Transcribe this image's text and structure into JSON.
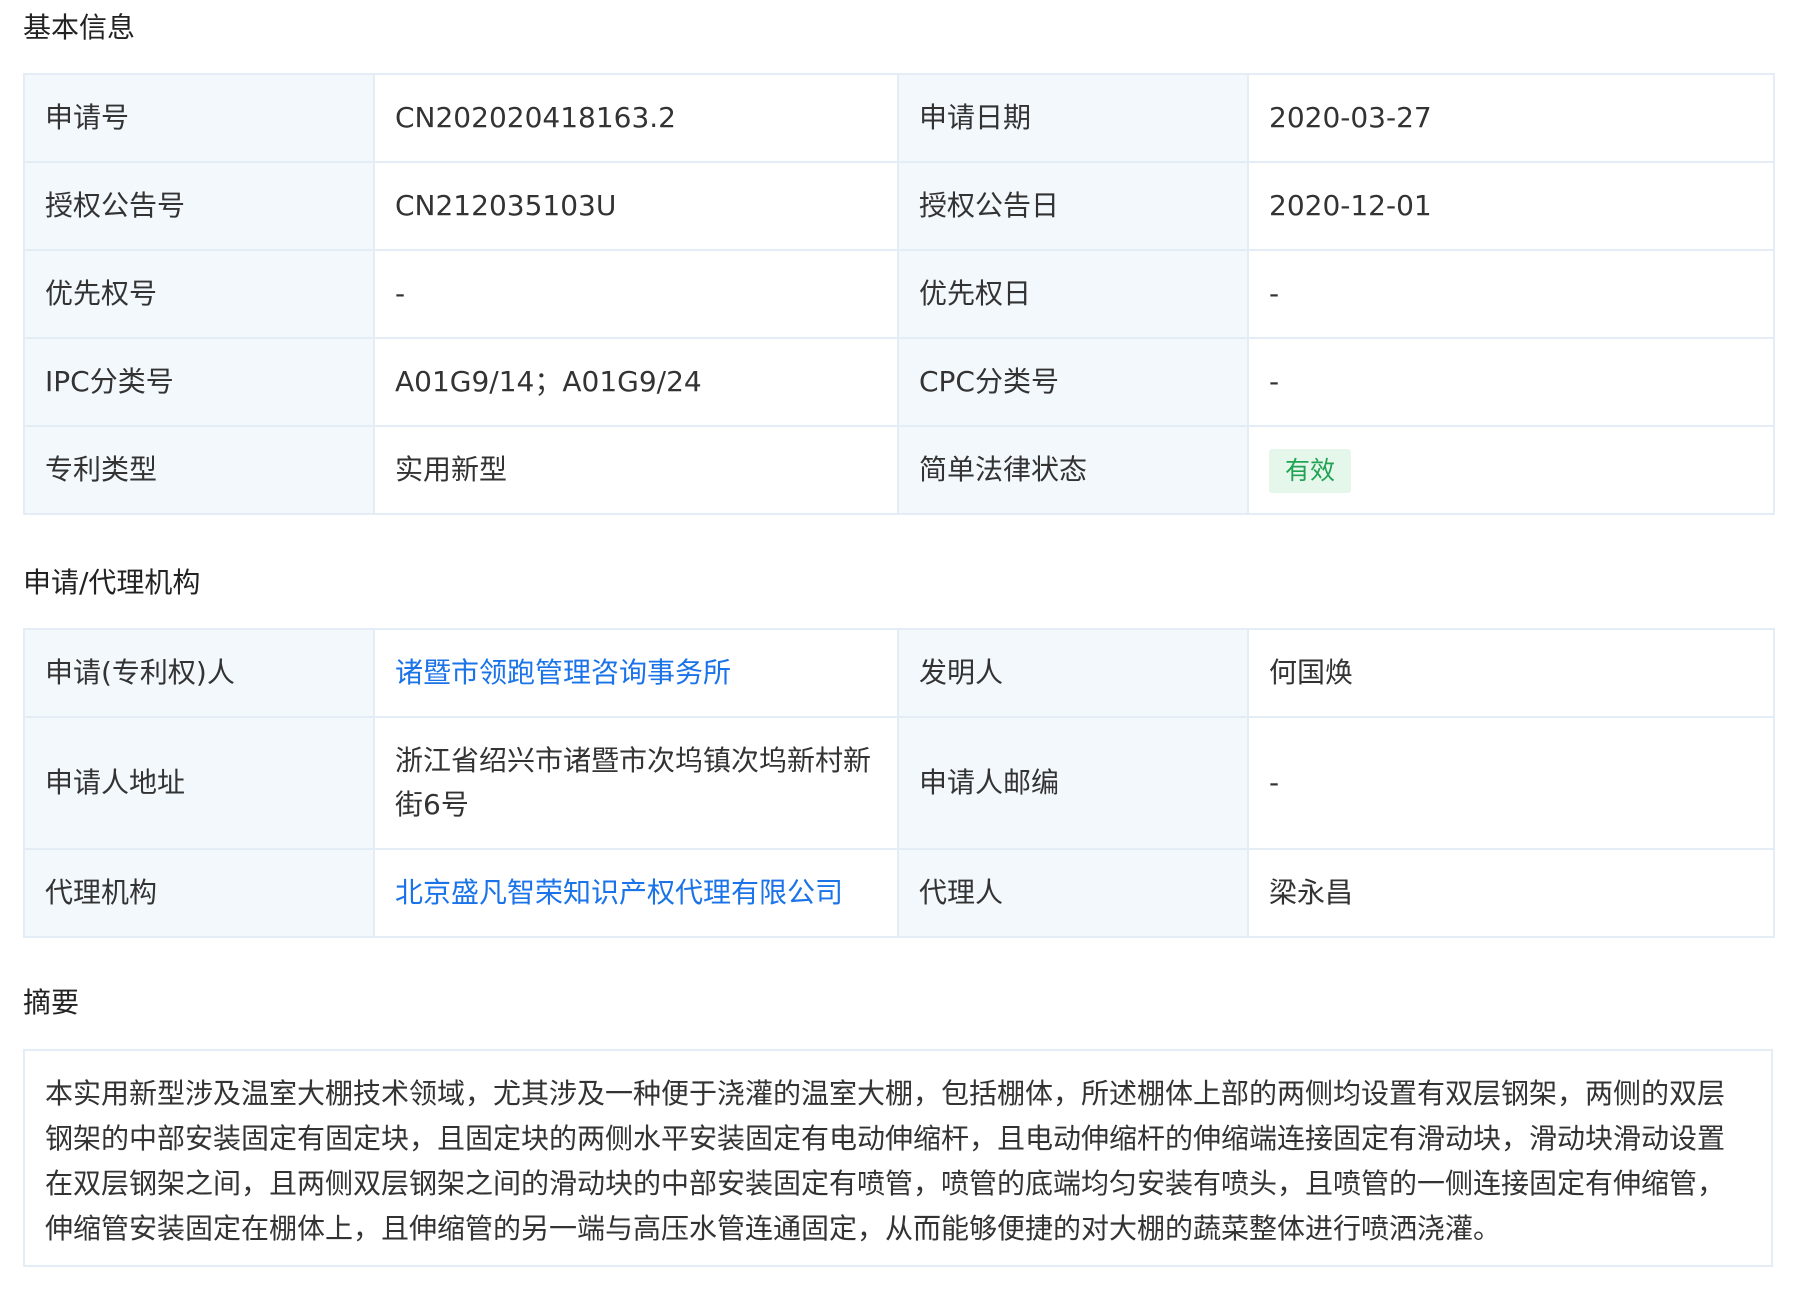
{
  "sections": {
    "basic": "基本信息",
    "agency": "申请/代理机构",
    "abstract": "摘要"
  },
  "basic": {
    "app_no_label": "申请号",
    "app_no": "CN202020418163.2",
    "app_date_label": "申请日期",
    "app_date": "2020-03-27",
    "grant_no_label": "授权公告号",
    "grant_no": "CN212035103U",
    "grant_date_label": "授权公告日",
    "grant_date": "2020-12-01",
    "priority_no_label": "优先权号",
    "priority_no": "-",
    "priority_date_label": "优先权日",
    "priority_date": "-",
    "ipc_label": "IPC分类号",
    "ipc": "A01G9/14；A01G9/24",
    "cpc_label": "CPC分类号",
    "cpc": "-",
    "type_label": "专利类型",
    "type": "实用新型",
    "status_label": "简单法律状态",
    "status": "有效"
  },
  "agency": {
    "applicant_label": "申请(专利权)人",
    "applicant": "诸暨市领跑管理咨询事务所",
    "inventor_label": "发明人",
    "inventor": "何国焕",
    "address_label": "申请人地址",
    "address": "浙江省绍兴市诸暨市次坞镇次坞新村新街6号",
    "postcode_label": "申请人邮编",
    "postcode": "-",
    "agency_label": "代理机构",
    "agency_name": "北京盛凡智荣知识产权代理有限公司",
    "agent_label": "代理人",
    "agent": "梁永昌"
  },
  "abstract": {
    "text": "本实用新型涉及温室大棚技术领域，尤其涉及一种便于浇灌的温室大棚，包括棚体，所述棚体上部的两侧均设置有双层钢架，两侧的双层钢架的中部安装固定有固定块，且固定块的两侧水平安装固定有电动伸缩杆，且电动伸缩杆的伸缩端连接固定有滑动块，滑动块滑动设置在双层钢架之间，且两侧双层钢架之间的滑动块的中部安装固定有喷管，喷管的底端均匀安装有喷头，且喷管的一侧连接固定有伸缩管，伸缩管安装固定在棚体上，且伸缩管的另一端与高压水管连通固定，从而能够便捷的对大棚的蔬菜整体进行喷洒浇灌。"
  },
  "colors": {
    "link": "#1a73e8",
    "label_bg": "#f3f8fd",
    "border": "#e4ecf5",
    "status_bg": "#e5f6ea",
    "status_text": "#21a354"
  }
}
